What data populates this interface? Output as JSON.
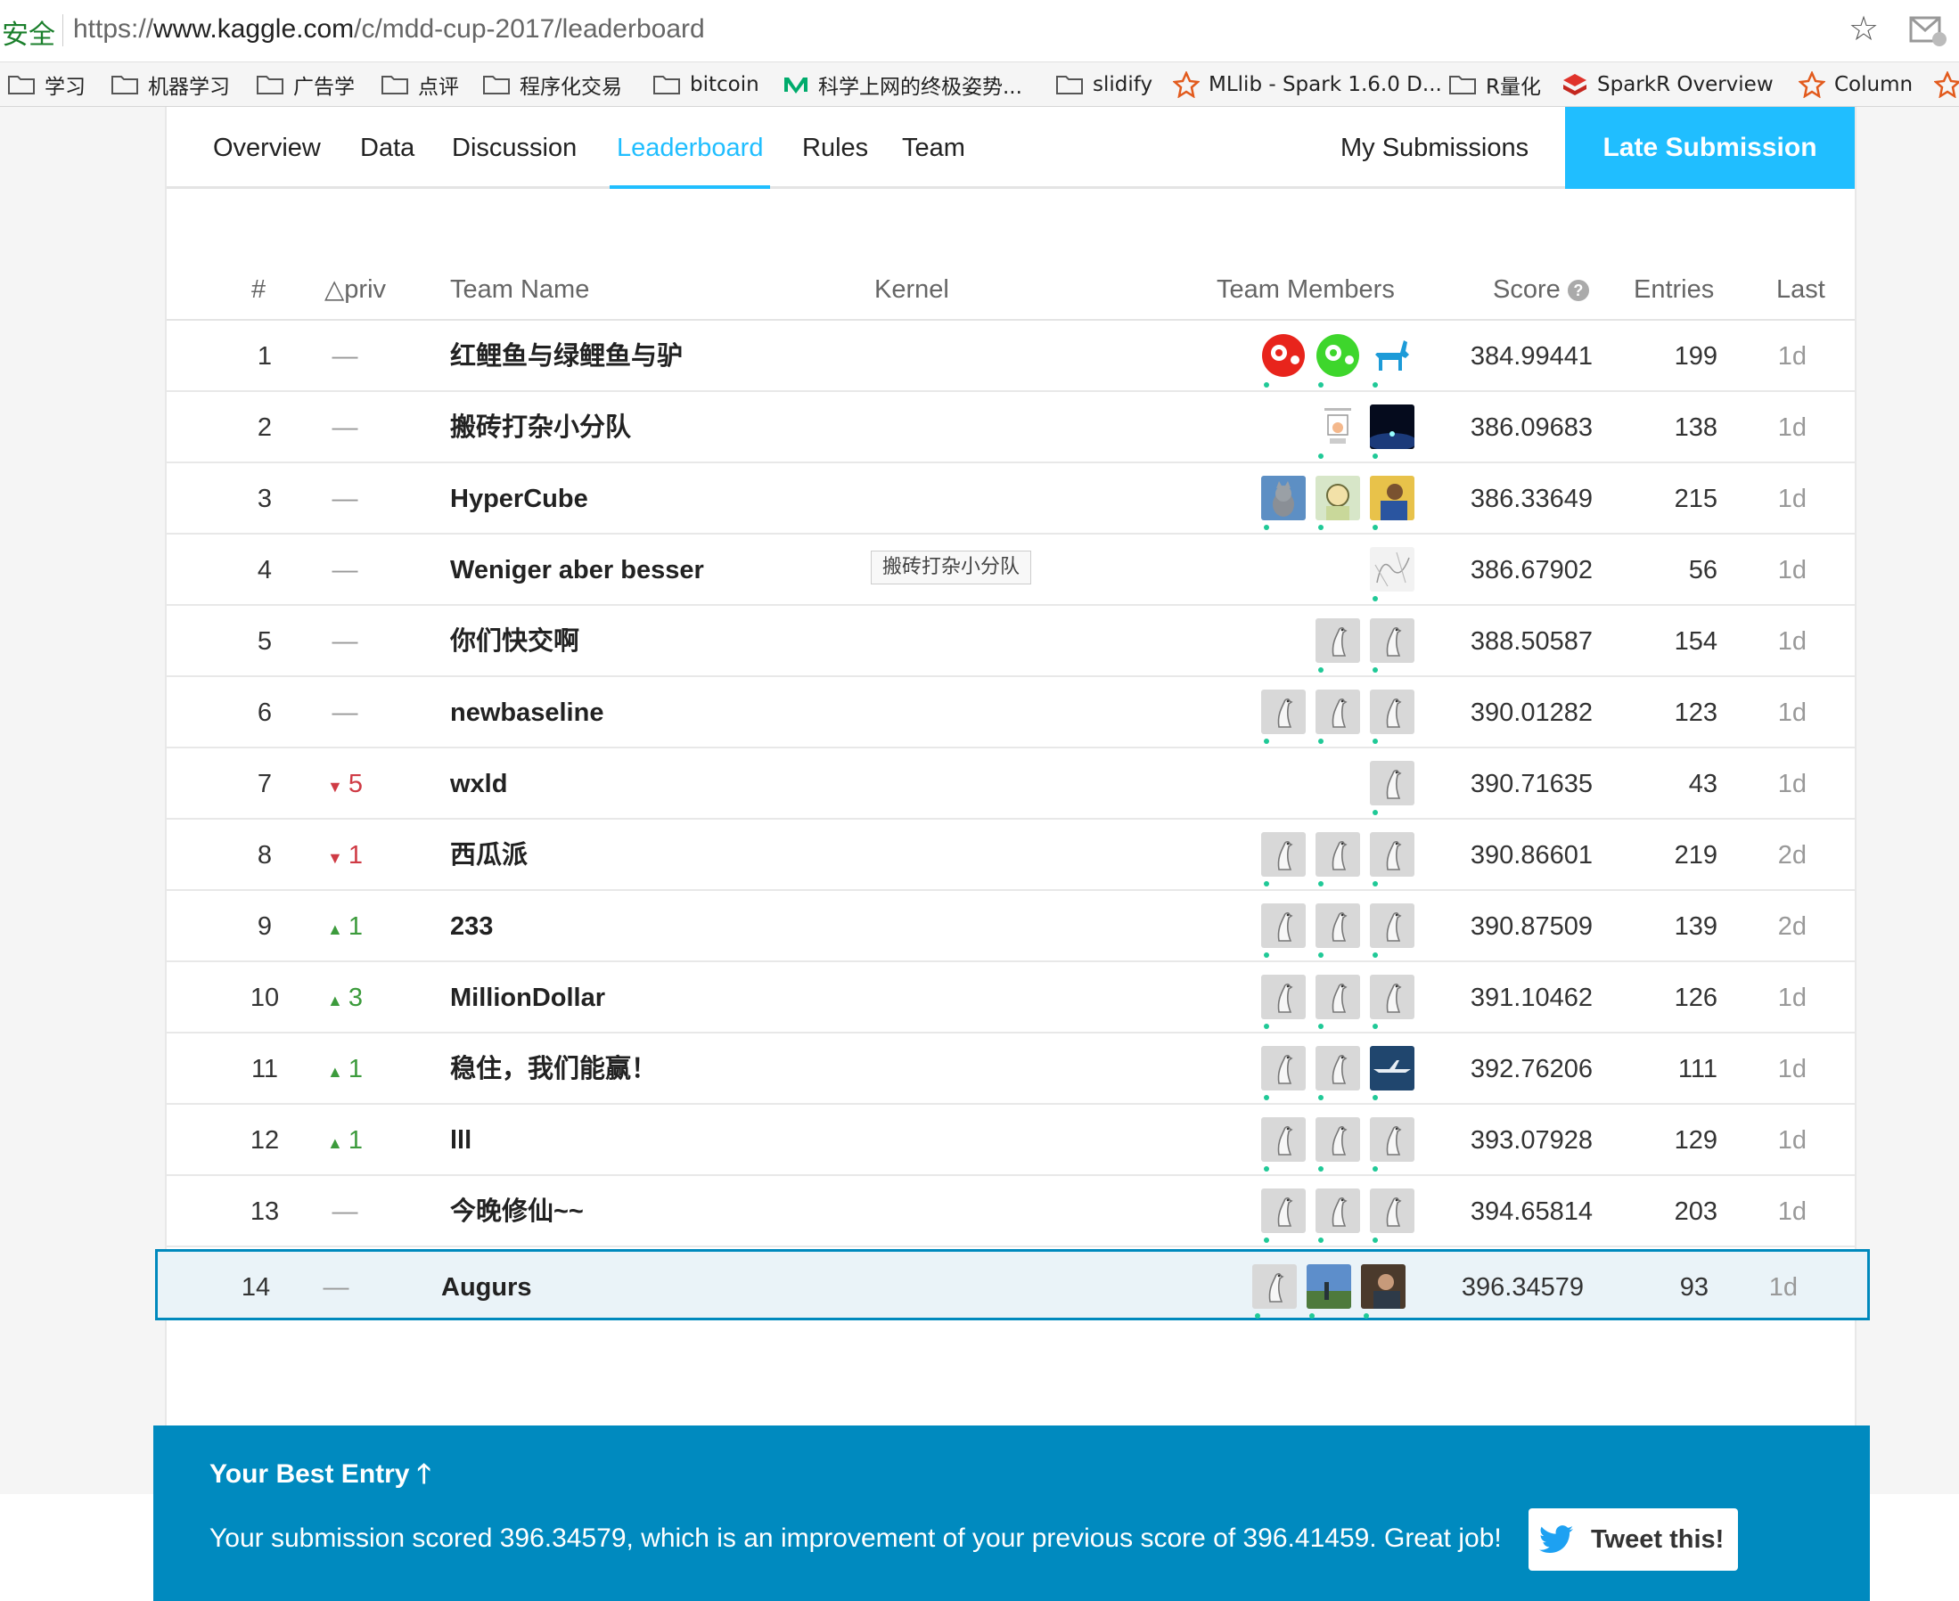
{
  "browser": {
    "secure_label": "安全",
    "url_scheme": "https://",
    "url_host": "www.kaggle.com",
    "url_path": "/c/mdd-cup-2017/leaderboard",
    "bookmarks": [
      "学习",
      "机器学习",
      "广告学",
      "点评",
      "程序化交易",
      "bitcoin",
      "科学上网的终极姿势...",
      "slidify",
      "MLlib - Spark 1.6.0 D...",
      "R量化",
      "SparkR Overview",
      "Column"
    ]
  },
  "nav": {
    "tabs": [
      "Overview",
      "Data",
      "Discussion",
      "Leaderboard",
      "Rules",
      "Team"
    ],
    "active_tab": "Leaderboard",
    "my_submissions": "My Submissions",
    "late_submission": "Late Submission"
  },
  "table": {
    "headers": {
      "rank": "#",
      "delta": "△priv",
      "team": "Team Name",
      "kernel": "Kernel",
      "members": "Team Members",
      "score": "Score",
      "entries": "Entries",
      "last": "Last"
    },
    "rows": [
      {
        "rank": "1",
        "delta": "—",
        "dir": "none",
        "team": "红鲤鱼与绿鲤鱼与驴",
        "avatars": [
          "red-fish",
          "green-fish",
          "blue-donkey"
        ],
        "score": "384.99441",
        "entries": "199",
        "last": "1d"
      },
      {
        "rank": "2",
        "delta": "—",
        "dir": "none",
        "team": "搬砖打杂小分队",
        "avatars": [
          "sketch",
          "space"
        ],
        "score": "386.09683",
        "entries": "138",
        "last": "1d"
      },
      {
        "rank": "3",
        "delta": "—",
        "dir": "none",
        "team": "HyperCube",
        "avatars": [
          "cat",
          "cartoon",
          "person"
        ],
        "score": "386.33649",
        "entries": "215",
        "last": "1d"
      },
      {
        "rank": "4",
        "delta": "—",
        "dir": "none",
        "team": "Weniger aber besser",
        "avatars": [
          "doodle"
        ],
        "score": "386.67902",
        "entries": "56",
        "last": "1d"
      },
      {
        "rank": "5",
        "delta": "—",
        "dir": "none",
        "team": "你们快交啊",
        "avatars": [
          "goose",
          "goose"
        ],
        "score": "388.50587",
        "entries": "154",
        "last": "1d"
      },
      {
        "rank": "6",
        "delta": "—",
        "dir": "none",
        "team": "newbaseline",
        "avatars": [
          "goose",
          "goose",
          "goose"
        ],
        "score": "390.01282",
        "entries": "123",
        "last": "1d"
      },
      {
        "rank": "7",
        "delta": "5",
        "dir": "down",
        "team": "wxld",
        "avatars": [
          "goose"
        ],
        "score": "390.71635",
        "entries": "43",
        "last": "1d"
      },
      {
        "rank": "8",
        "delta": "1",
        "dir": "down",
        "team": "西瓜派",
        "avatars": [
          "goose",
          "goose",
          "goose"
        ],
        "score": "390.86601",
        "entries": "219",
        "last": "2d"
      },
      {
        "rank": "9",
        "delta": "1",
        "dir": "up",
        "team": "233",
        "avatars": [
          "goose",
          "goose",
          "goose"
        ],
        "score": "390.87509",
        "entries": "139",
        "last": "2d"
      },
      {
        "rank": "10",
        "delta": "3",
        "dir": "up",
        "team": "MillionDollar",
        "avatars": [
          "goose",
          "goose",
          "goose"
        ],
        "score": "391.10462",
        "entries": "126",
        "last": "1d"
      },
      {
        "rank": "11",
        "delta": "1",
        "dir": "up",
        "team": "稳住，我们能赢！",
        "avatars": [
          "goose",
          "goose",
          "plane"
        ],
        "score": "392.76206",
        "entries": "111",
        "last": "1d"
      },
      {
        "rank": "12",
        "delta": "1",
        "dir": "up",
        "team": "lll",
        "avatars": [
          "goose",
          "goose",
          "goose"
        ],
        "score": "393.07928",
        "entries": "129",
        "last": "1d"
      },
      {
        "rank": "13",
        "delta": "—",
        "dir": "none",
        "team": "今晚修仙~~",
        "avatars": [
          "goose",
          "goose",
          "goose"
        ],
        "score": "394.65814",
        "entries": "203",
        "last": "1d"
      },
      {
        "rank": "14",
        "delta": "—",
        "dir": "none",
        "team": "Augurs",
        "avatars": [
          "goose",
          "landscape",
          "photo"
        ],
        "score": "396.34579",
        "entries": "93",
        "last": "1d"
      }
    ]
  },
  "tooltip": "搬砖打杂小分队",
  "best_entry": {
    "title": "Your Best Entry",
    "message": "Your submission scored 396.34579, which is an improvement of your previous score of 396.41459. Great job!",
    "tweet": "Tweet this!"
  },
  "colors": {
    "accent": "#20beff",
    "banner": "#008abf",
    "up": "#3c9b3c",
    "down": "#cf3b45"
  }
}
